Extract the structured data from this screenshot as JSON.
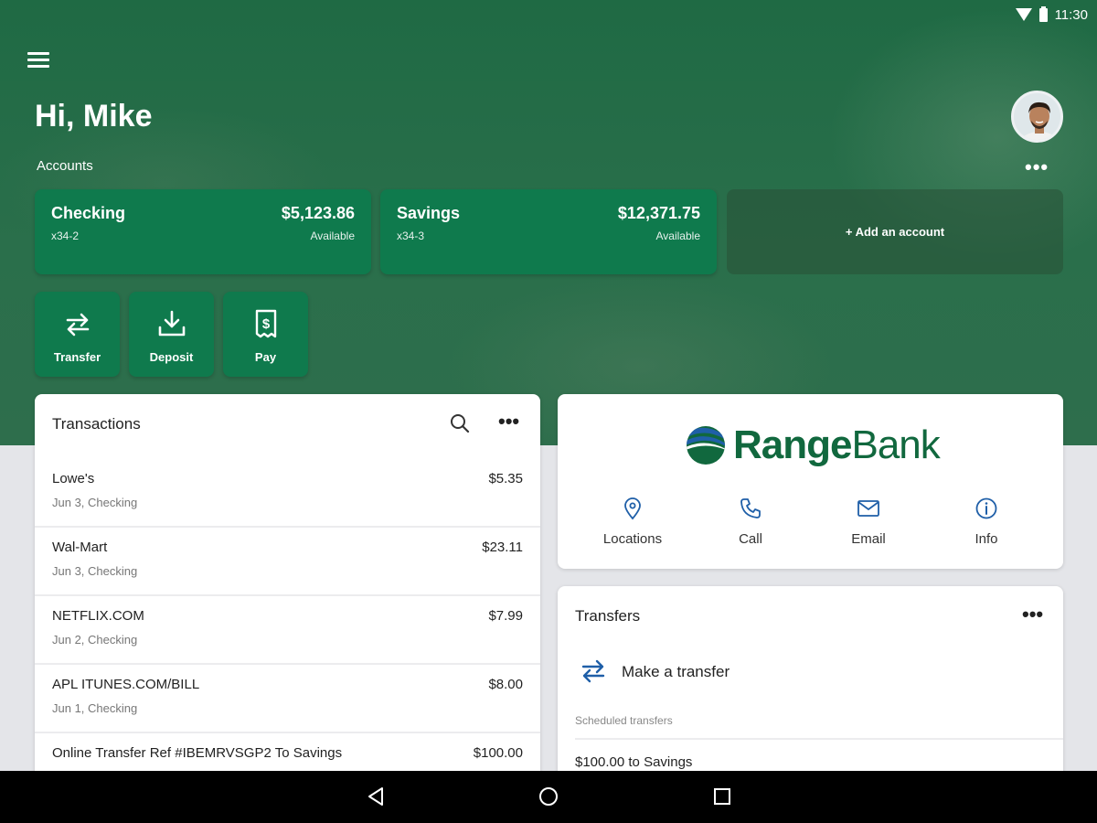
{
  "status_bar": {
    "time": "11:30",
    "icons": [
      "wifi-icon",
      "battery-icon"
    ]
  },
  "header": {
    "greeting": "Hi, Mike",
    "accounts_label": "Accounts",
    "more_label": "•••"
  },
  "accounts": [
    {
      "name": "Checking",
      "number": "x34-2",
      "balance": "$5,123.86",
      "balance_label": "Available"
    },
    {
      "name": "Savings",
      "number": "x34-3",
      "balance": "$12,371.75",
      "balance_label": "Available"
    }
  ],
  "add_account_label": "+ Add an account",
  "actions": [
    {
      "label": "Transfer",
      "icon": "transfer-icon"
    },
    {
      "label": "Deposit",
      "icon": "deposit-icon"
    },
    {
      "label": "Pay",
      "icon": "pay-icon"
    }
  ],
  "transactions": {
    "title": "Transactions",
    "more_label": "•••",
    "items": [
      {
        "name": "Lowe's",
        "detail": "Jun 3, Checking",
        "amount": "$5.35"
      },
      {
        "name": "Wal-Mart",
        "detail": "Jun 3, Checking",
        "amount": "$23.11"
      },
      {
        "name": "NETFLIX.COM",
        "detail": "Jun 2, Checking",
        "amount": "$7.99"
      },
      {
        "name": "APL ITUNES.COM/BILL",
        "detail": "Jun 1, Checking",
        "amount": "$8.00"
      },
      {
        "name": "Online Transfer Ref #IBEMRVSGP2 To Savings",
        "detail": "",
        "amount": "$100.00"
      }
    ]
  },
  "bank": {
    "name_bold": "Range",
    "name_light": "Bank",
    "contacts": [
      {
        "label": "Locations",
        "icon": "location-pin-icon"
      },
      {
        "label": "Call",
        "icon": "phone-icon"
      },
      {
        "label": "Email",
        "icon": "email-icon"
      },
      {
        "label": "Info",
        "icon": "info-icon"
      }
    ]
  },
  "transfers": {
    "title": "Transfers",
    "more_label": "•••",
    "make_transfer_label": "Make a transfer",
    "scheduled_label": "Scheduled transfers",
    "scheduled_items": [
      "$100.00 to Savings"
    ]
  },
  "colors": {
    "brand_green": "#0f7a4d",
    "hero_green": "#2a6f4b",
    "accent_blue": "#1f5fa8",
    "logo_green": "#11683e"
  }
}
